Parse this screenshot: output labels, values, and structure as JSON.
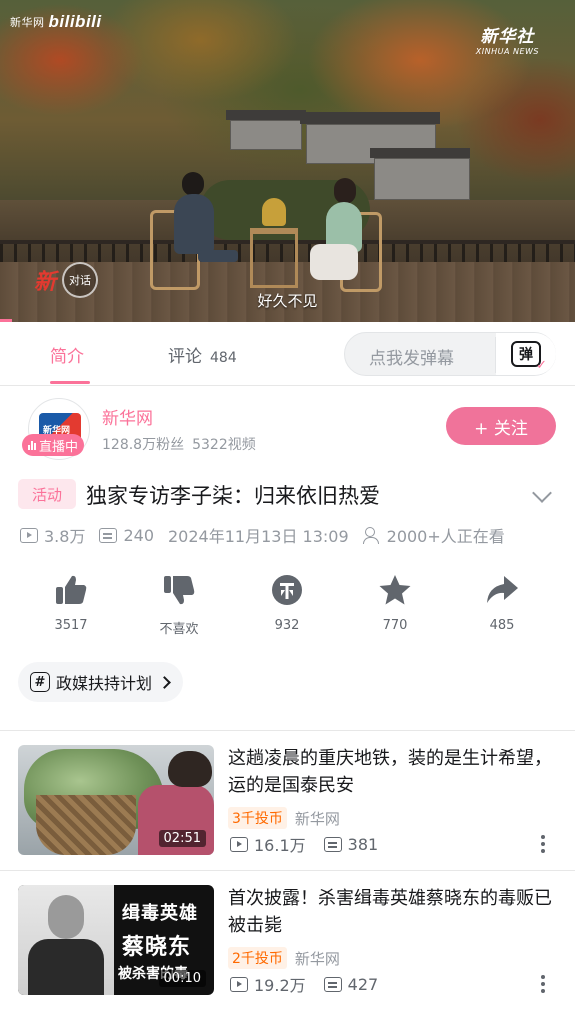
{
  "video": {
    "watermark_left_cn": "新华网",
    "watermark_left_brand": "bilibili",
    "watermark_right_big": "新华社",
    "watermark_right_small": "XINHUA NEWS",
    "badge_logo_char": "新",
    "badge_circle_text": "对话",
    "subtitle": "好久不见"
  },
  "tabs": {
    "intro": "简介",
    "comments": "评论",
    "comments_count": "484",
    "danmu_placeholder": "点我发弹幕",
    "danmu_icon_char": "弹"
  },
  "uploader": {
    "name": "新华网",
    "followers": "128.8万粉丝",
    "videos": "5322视频",
    "live_badge": "直播中",
    "avatar_text": "新华网",
    "follow_label": "+ 关注"
  },
  "video_info": {
    "activity_tag": "活动",
    "title": "独家专访李子柒：归来依旧热爱",
    "views": "3.8万",
    "danmaku": "240",
    "datetime": "2024年11月13日 13:09",
    "watching": "2000+人正在看"
  },
  "actions": {
    "like": "3517",
    "dislike": "不喜欢",
    "coin": "932",
    "favorite": "770",
    "share": "485"
  },
  "topic_chip": {
    "label": "政媒扶持计划",
    "icon_char": "#"
  },
  "recommendations": [
    {
      "title": "这趟凌晨的重庆地铁，装的是生计希望，运的是国泰民安",
      "coin_tag": "3千投币",
      "author": "新华网",
      "views": "16.1万",
      "danmaku": "381",
      "duration": "02:51"
    },
    {
      "title": "首次披露！杀害缉毒英雄蔡晓东的毒贩已被击毙",
      "coin_tag": "2千投币",
      "author": "新华网",
      "views": "19.2万",
      "danmaku": "427",
      "duration": "00:10",
      "thumb_text_1": "缉毒英雄",
      "thumb_text_2": "蔡晓东",
      "thumb_text_3": "被杀害的毒"
    }
  ],
  "colors": {
    "brand_pink": "#fb7299",
    "coin_orange": "#ff6a00",
    "text_primary": "#18191c",
    "text_secondary": "#9499a0"
  }
}
